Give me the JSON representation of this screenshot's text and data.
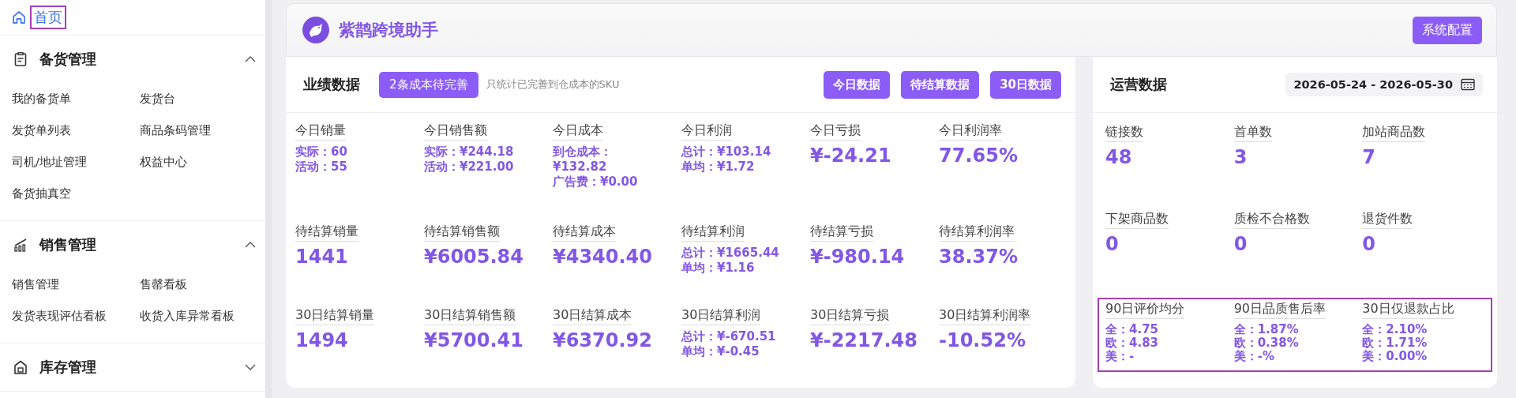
{
  "sidebar": {
    "home": {
      "label": "首页",
      "highlighted": true
    },
    "groups": [
      {
        "title": "备货管理",
        "expanded": true,
        "items": [
          "我的备货单",
          "发货台",
          "发货单列表",
          "商品条码管理",
          "司机/地址管理",
          "权益中心",
          "备货抽真空"
        ]
      },
      {
        "title": "销售管理",
        "expanded": true,
        "items": [
          "销售管理",
          "售罄看板",
          "发货表现评估看板",
          "收货入库异常看板"
        ]
      },
      {
        "title": "库存管理",
        "expanded": false
      }
    ]
  },
  "header": {
    "title": "紫鹊跨境助手",
    "button": "系统配置"
  },
  "performance": {
    "title": "业绩数据",
    "badge": "2条成本待完善",
    "note": "只统计已完善到仓成本的SKU",
    "buttons": [
      "今日数据",
      "待结算数据",
      "30日数据"
    ],
    "rows": [
      [
        {
          "label": "今日销量",
          "kind": "lines",
          "lines": [
            "实际：60",
            "活动：55"
          ]
        },
        {
          "label": "今日销售额",
          "kind": "lines",
          "lines": [
            "实际：¥244.18",
            "活动：¥221.00"
          ]
        },
        {
          "label": "今日成本",
          "kind": "lines",
          "lines": [
            "到仓成本：¥132.82",
            "广告费：¥0.00"
          ]
        },
        {
          "label": "今日利润",
          "kind": "lines",
          "lines": [
            "总计：¥103.14",
            "单均：¥1.72"
          ]
        },
        {
          "label": "今日亏损",
          "kind": "value",
          "value": "¥-24.21"
        },
        {
          "label": "今日利润率",
          "kind": "value",
          "value": "77.65%"
        }
      ],
      [
        {
          "label": "待结算销量",
          "kind": "value",
          "value": "1441"
        },
        {
          "label": "待结算销售额",
          "kind": "value",
          "value": "¥6005.84"
        },
        {
          "label": "待结算成本",
          "kind": "value",
          "value": "¥4340.40"
        },
        {
          "label": "待结算利润",
          "kind": "lines",
          "lines": [
            "总计：¥1665.44",
            "单均：¥1.16"
          ]
        },
        {
          "label": "待结算亏损",
          "kind": "value",
          "value": "¥-980.14"
        },
        {
          "label": "待结算利润率",
          "kind": "value",
          "value": "38.37%"
        }
      ],
      [
        {
          "label": "30日结算销量",
          "kind": "value",
          "value": "1494"
        },
        {
          "label": "30日结算销售额",
          "kind": "value",
          "value": "¥5700.41"
        },
        {
          "label": "30日结算成本",
          "kind": "value",
          "value": "¥6370.92"
        },
        {
          "label": "30日结算利润",
          "kind": "lines",
          "lines": [
            "总计：¥-670.51",
            "单均：¥-0.45"
          ]
        },
        {
          "label": "30日结算亏损",
          "kind": "value",
          "value": "¥-2217.48"
        },
        {
          "label": "30日结算利润率",
          "kind": "value",
          "value": "-10.52%"
        }
      ]
    ]
  },
  "operations": {
    "title": "运营数据",
    "date_range": "2026-05-24 - 2026-05-30",
    "rows": [
      {
        "highlighted": false,
        "metrics": [
          {
            "label": "链接数",
            "kind": "value",
            "value": "48"
          },
          {
            "label": "首单数",
            "kind": "value",
            "value": "3"
          },
          {
            "label": "加站商品数",
            "kind": "value",
            "value": "7"
          }
        ]
      },
      {
        "highlighted": false,
        "metrics": [
          {
            "label": "下架商品数",
            "kind": "value",
            "value": "0"
          },
          {
            "label": "质检不合格数",
            "kind": "value",
            "value": "0"
          },
          {
            "label": "退货件数",
            "kind": "value",
            "value": "0"
          }
        ]
      },
      {
        "highlighted": true,
        "metrics": [
          {
            "label": "90日评价均分",
            "kind": "lines",
            "lines": [
              "全：4.75",
              "欧：4.83",
              "美：-"
            ]
          },
          {
            "label": "90日品质售后率",
            "kind": "lines",
            "lines": [
              "全：1.87%",
              "欧：0.38%",
              "美：-%"
            ]
          },
          {
            "label": "30日仅退款占比",
            "kind": "lines",
            "lines": [
              "全：2.10%",
              "欧：1.71%",
              "美：0.00%"
            ]
          }
        ]
      }
    ]
  }
}
